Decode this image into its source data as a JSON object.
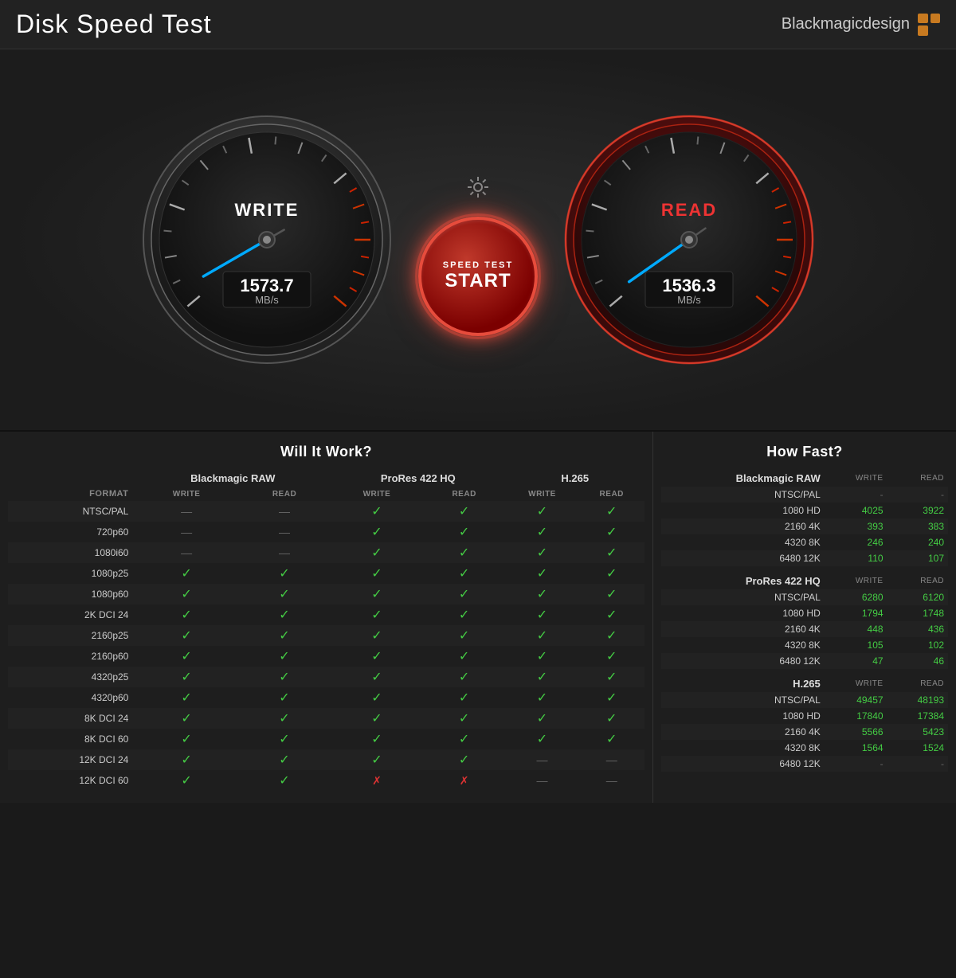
{
  "header": {
    "title": "Disk Speed Test",
    "brand": "Blackmagicdesign"
  },
  "gauges": {
    "write": {
      "label": "WRITE",
      "value": "1573.7",
      "unit": "MB/s",
      "needle_angle": -30
    },
    "read": {
      "label": "READ",
      "value": "1536.3",
      "unit": "MB/s",
      "needle_angle": -35
    },
    "start_button": {
      "line1": "SPEED TEST",
      "line2": "START"
    }
  },
  "will_it_work": {
    "title": "Will It Work?",
    "columns": {
      "format": "FORMAT",
      "blackmagic_raw": "Blackmagic RAW",
      "prores_422hq": "ProRes 422 HQ",
      "h265": "H.265"
    },
    "subheaders": [
      "WRITE",
      "READ",
      "WRITE",
      "READ",
      "WRITE",
      "READ"
    ],
    "rows": [
      {
        "format": "NTSC/PAL",
        "bm_w": "—",
        "bm_r": "—",
        "pr_w": "✓",
        "pr_r": "✓",
        "h_w": "✓",
        "h_r": "✓"
      },
      {
        "format": "720p60",
        "bm_w": "—",
        "bm_r": "—",
        "pr_w": "✓",
        "pr_r": "✓",
        "h_w": "✓",
        "h_r": "✓"
      },
      {
        "format": "1080i60",
        "bm_w": "—",
        "bm_r": "—",
        "pr_w": "✓",
        "pr_r": "✓",
        "h_w": "✓",
        "h_r": "✓"
      },
      {
        "format": "1080p25",
        "bm_w": "✓",
        "bm_r": "✓",
        "pr_w": "✓",
        "pr_r": "✓",
        "h_w": "✓",
        "h_r": "✓"
      },
      {
        "format": "1080p60",
        "bm_w": "✓",
        "bm_r": "✓",
        "pr_w": "✓",
        "pr_r": "✓",
        "h_w": "✓",
        "h_r": "✓"
      },
      {
        "format": "2K DCI 24",
        "bm_w": "✓",
        "bm_r": "✓",
        "pr_w": "✓",
        "pr_r": "✓",
        "h_w": "✓",
        "h_r": "✓"
      },
      {
        "format": "2160p25",
        "bm_w": "✓",
        "bm_r": "✓",
        "pr_w": "✓",
        "pr_r": "✓",
        "h_w": "✓",
        "h_r": "✓"
      },
      {
        "format": "2160p60",
        "bm_w": "✓",
        "bm_r": "✓",
        "pr_w": "✓",
        "pr_r": "✓",
        "h_w": "✓",
        "h_r": "✓"
      },
      {
        "format": "4320p25",
        "bm_w": "✓",
        "bm_r": "✓",
        "pr_w": "✓",
        "pr_r": "✓",
        "h_w": "✓",
        "h_r": "✓"
      },
      {
        "format": "4320p60",
        "bm_w": "✓",
        "bm_r": "✓",
        "pr_w": "✓",
        "pr_r": "✓",
        "h_w": "✓",
        "h_r": "✓"
      },
      {
        "format": "8K DCI 24",
        "bm_w": "✓",
        "bm_r": "✓",
        "pr_w": "✓",
        "pr_r": "✓",
        "h_w": "✓",
        "h_r": "✓"
      },
      {
        "format": "8K DCI 60",
        "bm_w": "✓",
        "bm_r": "✓",
        "pr_w": "✓",
        "pr_r": "✓",
        "h_w": "✓",
        "h_r": "✓"
      },
      {
        "format": "12K DCI 24",
        "bm_w": "✓",
        "bm_r": "✓",
        "pr_w": "✓",
        "pr_r": "✓",
        "h_w": "—",
        "h_r": "—"
      },
      {
        "format": "12K DCI 60",
        "bm_w": "✓",
        "bm_r": "✓",
        "pr_w": "✗",
        "pr_r": "✗",
        "h_w": "—",
        "h_r": "—"
      }
    ]
  },
  "how_fast": {
    "title": "How Fast?",
    "sections": [
      {
        "name": "Blackmagic RAW",
        "write_header": "WRITE",
        "read_header": "READ",
        "rows": [
          {
            "format": "NTSC/PAL",
            "write": "-",
            "read": "-"
          },
          {
            "format": "1080 HD",
            "write": "4025",
            "read": "3922"
          },
          {
            "format": "2160 4K",
            "write": "393",
            "read": "383"
          },
          {
            "format": "4320 8K",
            "write": "246",
            "read": "240"
          },
          {
            "format": "6480 12K",
            "write": "110",
            "read": "107"
          }
        ]
      },
      {
        "name": "ProRes 422 HQ",
        "write_header": "WRITE",
        "read_header": "READ",
        "rows": [
          {
            "format": "NTSC/PAL",
            "write": "6280",
            "read": "6120"
          },
          {
            "format": "1080 HD",
            "write": "1794",
            "read": "1748"
          },
          {
            "format": "2160 4K",
            "write": "448",
            "read": "436"
          },
          {
            "format": "4320 8K",
            "write": "105",
            "read": "102"
          },
          {
            "format": "6480 12K",
            "write": "47",
            "read": "46"
          }
        ]
      },
      {
        "name": "H.265",
        "write_header": "WRITE",
        "read_header": "READ",
        "rows": [
          {
            "format": "NTSC/PAL",
            "write": "49457",
            "read": "48193"
          },
          {
            "format": "1080 HD",
            "write": "17840",
            "read": "17384"
          },
          {
            "format": "2160 4K",
            "write": "5566",
            "read": "5423"
          },
          {
            "format": "4320 8K",
            "write": "1564",
            "read": "1524"
          },
          {
            "format": "6480 12K",
            "write": "-",
            "read": "-"
          }
        ]
      }
    ]
  }
}
